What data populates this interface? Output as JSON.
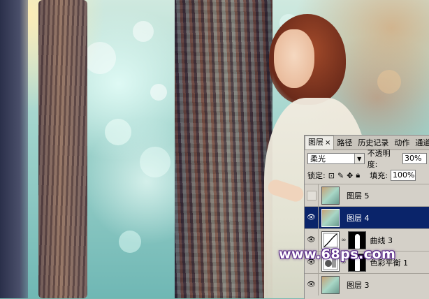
{
  "layers_panel": {
    "tabs": [
      "图层",
      "路径",
      "历史记录",
      "动作",
      "通道"
    ],
    "active_tab_index": 0,
    "tab_close_glyph": "×",
    "blend_mode": "柔光",
    "opacity_label": "不透明度:",
    "opacity_value": "30%",
    "lock_label": "锁定:",
    "fill_label": "填充:",
    "fill_value": "100%",
    "layers": [
      {
        "name": "图层 5",
        "visible": false,
        "selected": false,
        "kind": "pixel"
      },
      {
        "name": "图层 4",
        "visible": true,
        "selected": true,
        "kind": "pixel"
      },
      {
        "name": "曲线 3",
        "visible": true,
        "selected": false,
        "kind": "curves",
        "has_mask": true
      },
      {
        "name": "色彩平衡 1",
        "visible": true,
        "selected": false,
        "kind": "color-balance",
        "has_mask": true
      },
      {
        "name": "图层 3",
        "visible": true,
        "selected": false,
        "kind": "pixel"
      }
    ]
  },
  "watermark": {
    "text": "www.68ps.com"
  },
  "colors": {
    "selection": "#0a246a",
    "panel_bg": "#d4d0c8",
    "watermark_outline": "#5a2a8a"
  }
}
